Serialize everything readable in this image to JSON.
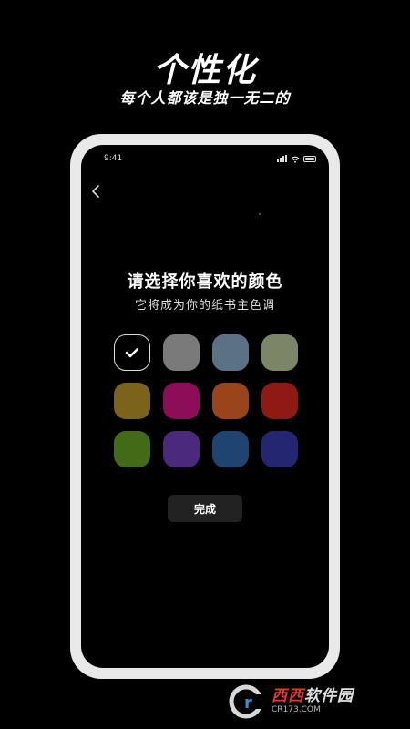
{
  "header": {
    "title": "个性化",
    "subtitle": "每个人都该是独一无二的"
  },
  "status_bar": {
    "time": "9:41"
  },
  "screen": {
    "title": "请选择你喜欢的颜色",
    "subtitle": "它将成为你的纸书主色调",
    "done_label": "完成"
  },
  "swatches": [
    {
      "color": "#000000",
      "selected": true
    },
    {
      "color": "#7a7a7a",
      "selected": false
    },
    {
      "color": "#5c7184",
      "selected": false
    },
    {
      "color": "#7d8569",
      "selected": false
    },
    {
      "color": "#7b6319",
      "selected": false
    },
    {
      "color": "#8c0e58",
      "selected": false
    },
    {
      "color": "#99441b",
      "selected": false
    },
    {
      "color": "#8e1a14",
      "selected": false
    },
    {
      "color": "#436a17",
      "selected": false
    },
    {
      "color": "#4b2a7e",
      "selected": false
    },
    {
      "color": "#1f4472",
      "selected": false
    },
    {
      "color": "#252671",
      "selected": false
    }
  ],
  "watermark": {
    "brand_prefix": "西西",
    "brand_suffix": "软件园",
    "url": "CR173.COM"
  },
  "icons": [
    "back-chevron-icon",
    "signal-icon",
    "wifi-icon",
    "battery-icon",
    "checkmark-icon"
  ]
}
